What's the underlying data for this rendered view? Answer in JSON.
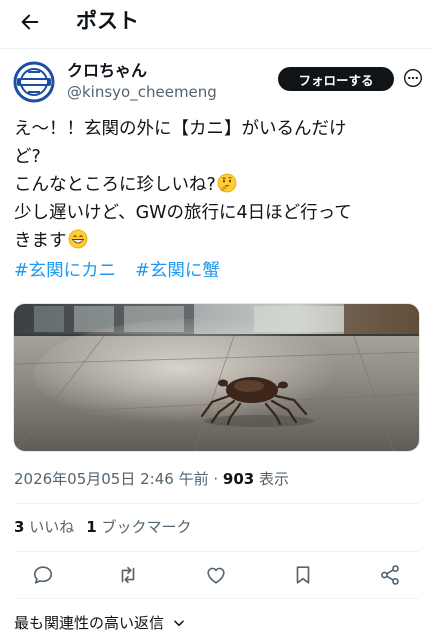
{
  "header": {
    "title": "ポスト",
    "back_icon": "arrow-left-icon"
  },
  "author": {
    "display_name": "クロちゃん",
    "handle": "@kinsyo_cheemeng",
    "avatar_icon": "logo-avatar-icon"
  },
  "follow_label": "フォローする",
  "more_icon": "more-icon",
  "tweet": {
    "lines": [
      "え〜！！玄関の外に【カニ】がいるんだけ",
      "ど?",
      "こんなところに珍しいね?",
      "少し遅いけど、GWの旅行に4日ほど行って",
      "きます"
    ],
    "emoji_thinking": "thinking-face-emoji",
    "emoji_grin": "grinning-face-emoji",
    "hashtags": [
      "#玄関にカニ",
      "#玄関に蟹"
    ]
  },
  "media": {
    "icon": "crab-photo"
  },
  "meta": {
    "timestamp": "2026年05月05日 2:46 午前",
    "separator": "·",
    "views_count": "903",
    "views_label": "表示"
  },
  "stats": {
    "likes_count": "3",
    "likes_label": "いいね",
    "bookmarks_count": "1",
    "bookmarks_label": "ブックマーク"
  },
  "actions": [
    "reply-icon",
    "retweet-icon",
    "like-icon",
    "bookmark-icon",
    "share-icon"
  ],
  "replies_sort": {
    "label": "最も関連性の高い返信",
    "icon": "chevron-down-icon"
  },
  "colors": {
    "link": "#1d9bf0",
    "text": "#0f1419",
    "secondary": "#536471",
    "button": "#0f1419"
  }
}
